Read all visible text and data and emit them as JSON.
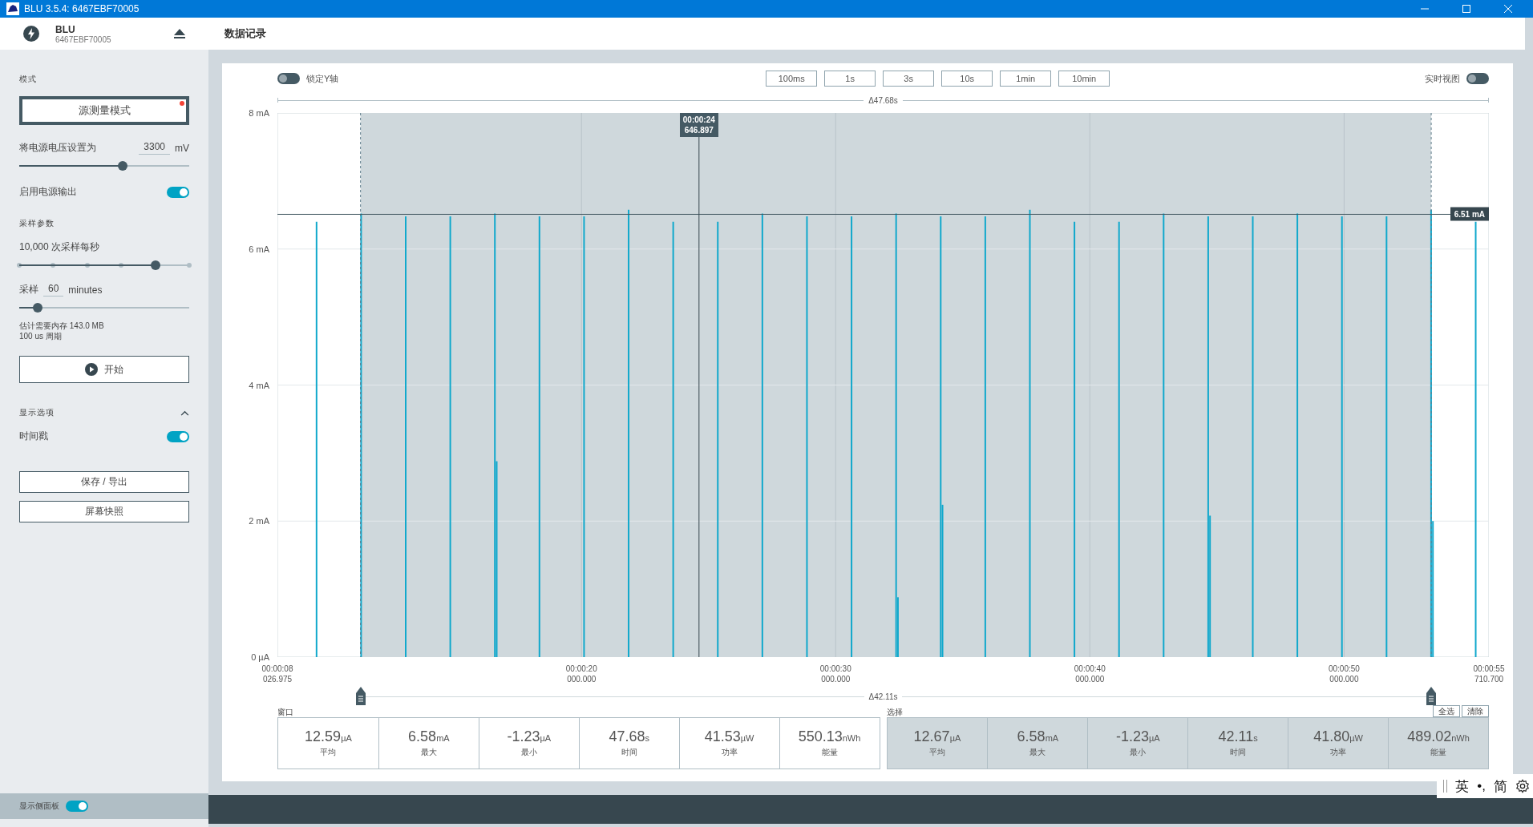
{
  "window": {
    "title": "BLU 3.5.4: 6467EBF70005"
  },
  "device": {
    "name": "BLU",
    "serial": "6467EBF70005"
  },
  "page_title": "数据记录",
  "sidebar": {
    "mode": {
      "heading": "模式",
      "button": "源测量模式",
      "alert": true
    },
    "voltage": {
      "label": "将电源电压设置为",
      "value": "3300",
      "unit": "mV",
      "level": 0.61
    },
    "power_output": {
      "label": "启用电源输出",
      "on": true
    },
    "sampling_heading": "采样参数",
    "rate": {
      "label": "10,000 次采样每秒",
      "level": 0.8
    },
    "duration": {
      "prefix": "采样",
      "value": "60",
      "unit": "minutes",
      "level": 0.107
    },
    "estimate": [
      "估计需要内存 143.0 MB",
      "100 us 周期"
    ],
    "start_button": "开始",
    "display": {
      "heading": "显示选项",
      "expanded": true
    },
    "timestamp": {
      "label": "时间戳",
      "on": true
    },
    "buttons": [
      "保存 / 导出",
      "屏幕快照"
    ],
    "footer": {
      "label": "显示侧面板",
      "on": true
    }
  },
  "chart": {
    "lock_y": {
      "label": "锁定Y轴",
      "on": false
    },
    "ranges": [
      "100ms",
      "1s",
      "3s",
      "10s",
      "1min",
      "10min"
    ],
    "live_view": {
      "label": "实时视图",
      "on": false
    },
    "window_delta": "Δ47.68s",
    "y_labels": [
      "8 mA",
      "6 mA",
      "4 mA",
      "2 mA",
      "0 µA"
    ],
    "x_labels": [
      {
        "time": "00:00:08",
        "ms": "026.975"
      },
      {
        "time": "00:00:20",
        "ms": "000.000"
      },
      {
        "time": "00:00:30",
        "ms": "000.000"
      },
      {
        "time": "00:00:40",
        "ms": "000.000"
      },
      {
        "time": "00:00:50",
        "ms": "000.000"
      },
      {
        "time": "00:00:55",
        "ms": "710.700"
      }
    ],
    "cursor": {
      "time": "00:00:24",
      "value": "646.897"
    },
    "level_marker": "6.51 mA",
    "selection_delta": "Δ42.11s"
  },
  "stats": {
    "window": {
      "title": "窗口",
      "items": [
        {
          "value": "12.59",
          "unit": "µA",
          "label": "平均"
        },
        {
          "value": "6.58",
          "unit": "mA",
          "label": "最大"
        },
        {
          "value": "-1.23",
          "unit": "µA",
          "label": "最小"
        },
        {
          "value": "47.68",
          "unit": "s",
          "label": "时间"
        },
        {
          "value": "41.53",
          "unit": "µW",
          "label": "功率"
        },
        {
          "value": "550.13",
          "unit": "nWh",
          "label": "能量"
        }
      ]
    },
    "selection": {
      "title": "选择",
      "actions": [
        "全选",
        "清除"
      ],
      "items": [
        {
          "value": "12.67",
          "unit": "µA",
          "label": "平均"
        },
        {
          "value": "6.58",
          "unit": "mA",
          "label": "最大"
        },
        {
          "value": "-1.23",
          "unit": "µA",
          "label": "最小"
        },
        {
          "value": "42.11",
          "unit": "s",
          "label": "时间"
        },
        {
          "value": "41.80",
          "unit": "µW",
          "label": "功率"
        },
        {
          "value": "489.02",
          "unit": "nWh",
          "label": "能量"
        }
      ]
    }
  },
  "ime": [
    "英",
    "•,",
    "简"
  ]
}
